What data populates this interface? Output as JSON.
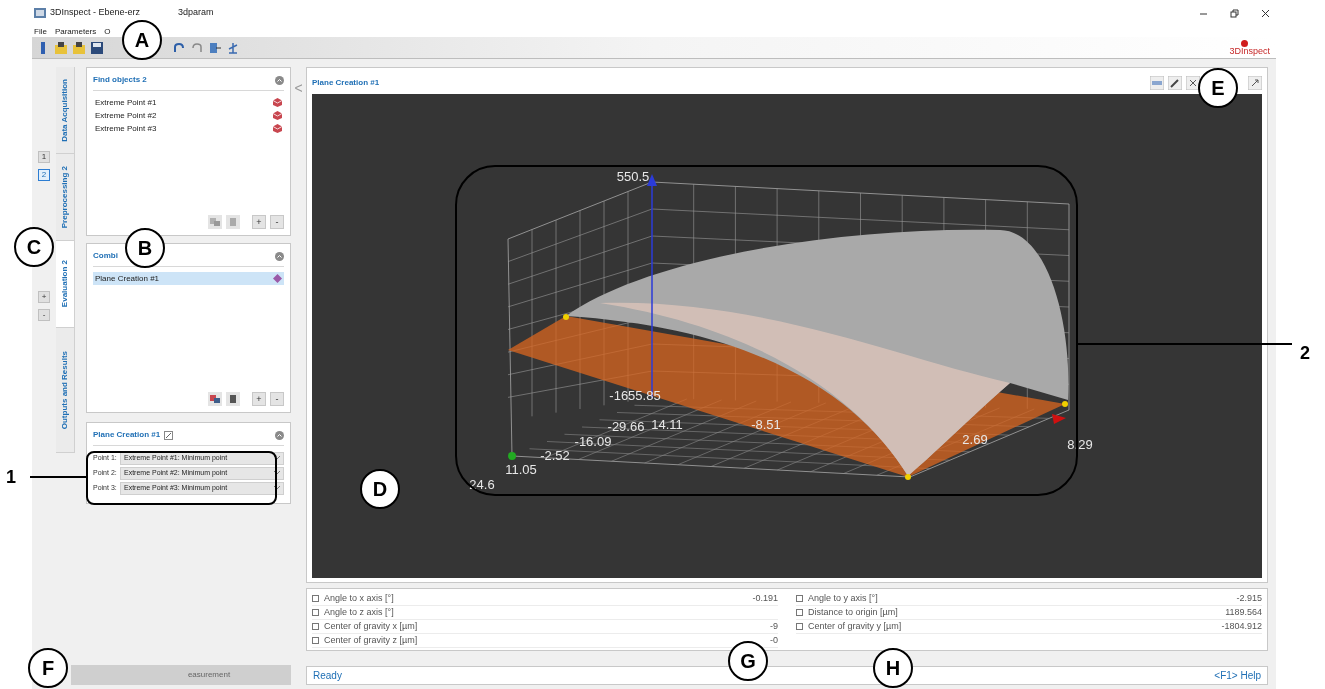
{
  "window": {
    "title_parts": [
      "3DInspect - Ebene-erz",
      "3dparam"
    ]
  },
  "menu": [
    "File",
    "Parameters",
    "O"
  ],
  "logo": {
    "text": "3DInspect"
  },
  "pages": [
    {
      "label": "1",
      "selected": false
    },
    {
      "label": "2",
      "selected": true
    }
  ],
  "page_buttons": [
    "+",
    "-"
  ],
  "tabs": [
    {
      "label": "Data Acquisition",
      "selected": false
    },
    {
      "label": "Preprocessing 2",
      "selected": false
    },
    {
      "label": "Evaluation 2",
      "selected": true
    },
    {
      "label": "Outputs and Results",
      "selected": false
    }
  ],
  "panels": [
    {
      "kind": "list",
      "title": "Find objects 2",
      "items": [
        {
          "label": "Extreme Point #1",
          "selected": false
        },
        {
          "label": "Extreme Point #2",
          "selected": false
        },
        {
          "label": "Extreme Point #3",
          "selected": false
        }
      ],
      "buttons": [
        "+",
        "-"
      ],
      "actions_enabled": false
    },
    {
      "kind": "list",
      "title": "Combi",
      "items": [
        {
          "label": "Plane Creation #1",
          "selected": true
        }
      ],
      "buttons": [
        "+",
        "-"
      ],
      "actions_enabled": true
    },
    {
      "kind": "params",
      "title": "Plane Creation #1",
      "fields": [
        {
          "label": "Point 1:",
          "value": "Extreme Point #1: Minimum point"
        },
        {
          "label": "Point 2:",
          "value": "Extreme Point #2: Minimum point"
        },
        {
          "label": "Point 3:",
          "value": "Extreme Point #3: Minimum point"
        }
      ]
    }
  ],
  "collapse_button": {
    "label": "<"
  },
  "viewer": {
    "title": "Plane Creation #1",
    "axis_labels": [
      "550.5",
      "-1655.85",
      "-29.66",
      "14.11",
      "-16.09",
      "-2.52",
      "11.05",
      "24.6",
      "-8.51",
      "2.69",
      "8.29"
    ]
  },
  "results": [
    {
      "label": "Angle to x axis [°]",
      "value": "-0.191",
      "checked": false
    },
    {
      "label": "Angle to y axis [°]",
      "value": "-2.915",
      "checked": false
    },
    {
      "label": "Angle to z axis [°]",
      "checked": false
    },
    {
      "label": "Distance to origin [µm]",
      "value": "1189.564",
      "checked": false
    },
    {
      "label": "Center of gravity x [µm]",
      "value": "-9",
      "checked": false
    },
    {
      "label": "Center of gravity y [µm]",
      "value": "-1804.912",
      "checked": false
    },
    {
      "label": "Center of gravity z [µm]",
      "value": "-0",
      "checked": false
    }
  ],
  "measure_button": {
    "label": "easurement",
    "disabled": true
  },
  "status_bar": {
    "text": "Ready",
    "help": "<F1> Help"
  },
  "callouts": [
    {
      "kind": "circle",
      "label": "A"
    },
    {
      "kind": "circle",
      "label": "B"
    },
    {
      "kind": "circle",
      "label": "C"
    },
    {
      "kind": "circle",
      "label": "D"
    },
    {
      "kind": "circle",
      "label": "E"
    },
    {
      "kind": "circle",
      "label": "F"
    },
    {
      "kind": "circle",
      "label": "G"
    },
    {
      "kind": "circle",
      "label": "H"
    },
    {
      "kind": "number",
      "label": "1"
    },
    {
      "kind": "number",
      "label": "2"
    }
  ]
}
